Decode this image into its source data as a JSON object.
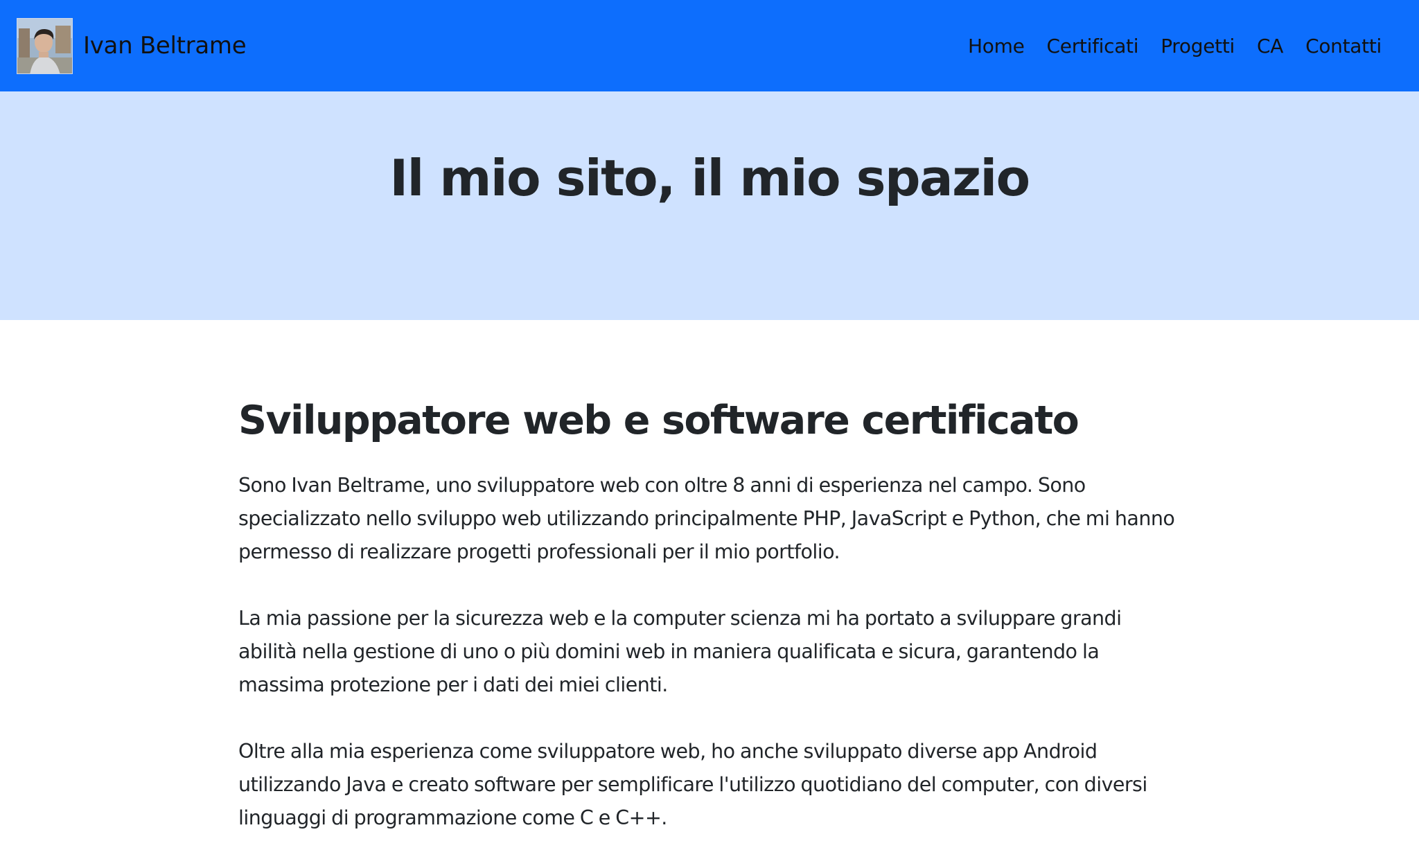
{
  "navbar": {
    "brand_name": "Ivan Beltrame",
    "avatar_alt": "profile-photo",
    "links": [
      {
        "label": "Home"
      },
      {
        "label": "Certificati"
      },
      {
        "label": "Progetti"
      },
      {
        "label": "CA"
      },
      {
        "label": "Contatti"
      }
    ],
    "colors": {
      "background": "#0d6efd",
      "text": "#111111"
    }
  },
  "hero": {
    "title": "Il mio sito, il mio spazio",
    "background": "#cfe2ff"
  },
  "about": {
    "heading": "Sviluppatore web e software certificato",
    "paragraphs": [
      "Sono Ivan Beltrame, uno sviluppatore web con oltre 8 anni di esperienza nel campo. Sono specializzato nello sviluppo web utilizzando principalmente PHP, JavaScript e Python, che mi hanno permesso di realizzare progetti professionali per il mio portfolio.",
      "La mia passione per la sicurezza web e la computer scienza mi ha portato a sviluppare grandi abilità nella gestione di uno o più domini web in maniera qualificata e sicura, garantendo la massima protezione per i dati dei miei clienti.",
      "Oltre alla mia esperienza come sviluppatore web, ho anche sviluppato diverse app Android utilizzando Java e creato software per semplificare l'utilizzo quotidiano del computer, con diversi linguaggi di programmazione come C e C++."
    ]
  }
}
